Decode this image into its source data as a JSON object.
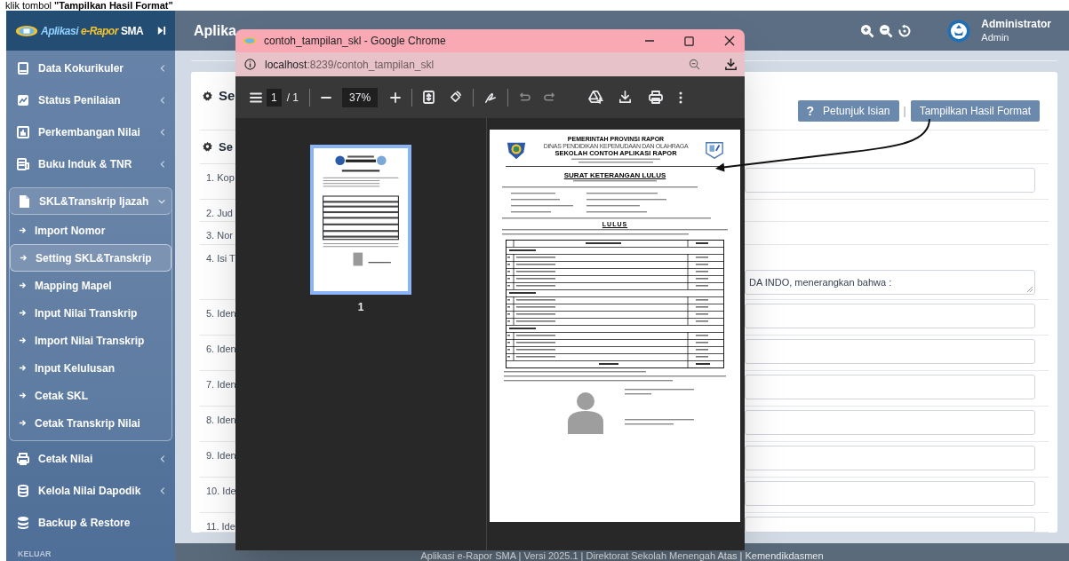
{
  "caption": "klik tombol **\"Tampilkan Hasil Format\"**",
  "app": {
    "logo": [
      "Aplikasi",
      "e-Rapor",
      "SMA"
    ],
    "title": "Aplika"
  },
  "user": {
    "name": "Administrator",
    "role": "Admin"
  },
  "sidebar": {
    "items": [
      {
        "label": "Data Kokurikuler",
        "expanded": false
      },
      {
        "label": "Status Penilaian",
        "expanded": false
      },
      {
        "label": "Perkembangan Nilai",
        "expanded": false
      },
      {
        "label": "Buku Induk & TNR",
        "expanded": false
      },
      {
        "label": "SKL&Transkrip Ijazah",
        "expanded": true,
        "children": [
          {
            "label": "Import Nomor",
            "selected": false
          },
          {
            "label": "Setting SKL&Transkrip",
            "selected": true
          },
          {
            "label": "Mapping Mapel",
            "selected": false
          },
          {
            "label": "Input Nilai Transkrip",
            "selected": false
          },
          {
            "label": "Import Nilai Transkrip",
            "selected": false
          },
          {
            "label": "Input Kelulusan",
            "selected": false
          },
          {
            "label": "Cetak SKL",
            "selected": false
          },
          {
            "label": "Cetak Transkrip Nilai",
            "selected": false
          }
        ]
      },
      {
        "label": "Cetak Nilai",
        "expanded": false
      },
      {
        "label": "Kelola Nilai Dapodik",
        "expanded": false
      },
      {
        "label": "Backup & Restore"
      }
    ],
    "bottom": "KELUAR"
  },
  "main": {
    "section_title": "Se",
    "buttons": [
      {
        "icon_text": "?",
        "label": "Petunjuk Isian"
      },
      {
        "label": "Tampilkan Hasil Format"
      }
    ],
    "separator": "|",
    "form_title": "Se",
    "rows": [
      {
        "label": "1. Kop",
        "kind": "input"
      },
      {
        "label": "2. Jud",
        "kind": "none"
      },
      {
        "label": "3. Nor",
        "kind": "none"
      },
      {
        "label": "4. Isi T",
        "kind": "textarea",
        "value": "DA INDO, menerangkan bahwa :"
      },
      {
        "label": "5. Iden",
        "kind": "input"
      },
      {
        "label": "6. Iden",
        "kind": "input"
      },
      {
        "label": "7. Iden",
        "kind": "input"
      },
      {
        "label": "8. Iden",
        "kind": "input"
      },
      {
        "label": "9. Iden",
        "kind": "input"
      },
      {
        "label": "10. Ide",
        "kind": "input"
      },
      {
        "label": "11. Ide",
        "kind": "input"
      }
    ]
  },
  "footer": "Aplikasi e-Rapor SMA | Versi 2025.1 | Direktorat Sekolah Menengah Atas | Kemendikdasmen",
  "browser": {
    "title": "contoh_tampilan_skl - Google Chrome",
    "url": "localhost:8239/contoh_tampilan_skl",
    "page": "1",
    "page_total": "/ 1",
    "zoom": "37%",
    "thumbnails": [
      {
        "label": "1",
        "selected": true
      }
    ],
    "document": {
      "header_lines": [
        "PEMERINTAH PROVINSI RAPOR",
        "DINAS PENDIDIKAN KEPEMUDAAN DAN OLAHRAGA",
        "SEKOLAH CONTOH APLIKASI RAPOR"
      ],
      "title": "SURAT KETERANGAN LULUS",
      "result": "LULUS"
    }
  }
}
